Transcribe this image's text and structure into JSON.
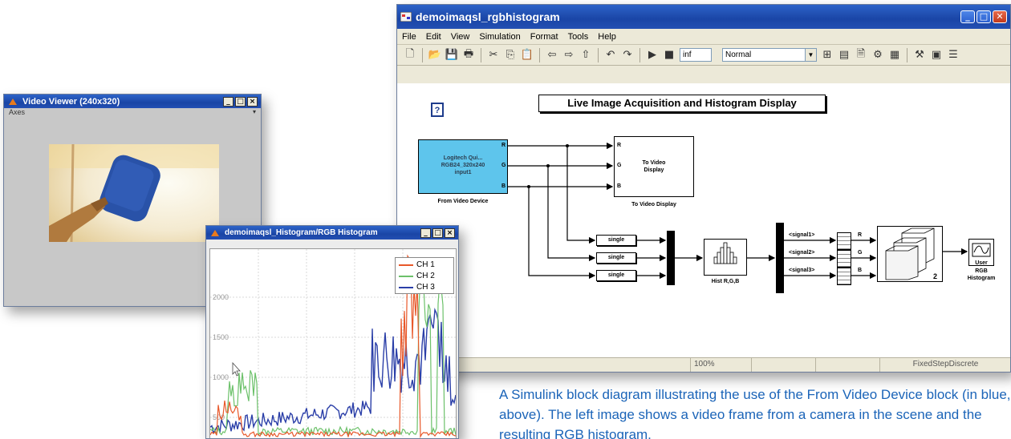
{
  "simulink": {
    "title": "demoimaqsl_rgbhistogram",
    "menu": [
      "File",
      "Edit",
      "View",
      "Simulation",
      "Format",
      "Tools",
      "Help"
    ],
    "stop_time": "inf",
    "sim_mode": "Normal",
    "diagram_title": "Live Image Acquisition and Histogram Display",
    "help_block": "?",
    "from_video": {
      "l1": "Logitech Qui...",
      "l2": "RGB24_320x240",
      "l3": "input1",
      "label": "From Video Device",
      "ports": [
        "R",
        "G",
        "B"
      ]
    },
    "to_video": {
      "l1": "To Video",
      "l2": "Display",
      "label": "To Video Display",
      "ports": [
        "R",
        "G",
        "B"
      ]
    },
    "single_blocks": [
      "single",
      "single",
      "single"
    ],
    "hist_label": "Hist R,G,B",
    "signals": [
      "<signal1>",
      "<signal2>",
      "<signal3>"
    ],
    "rgb_out": [
      "R",
      "G",
      "B"
    ],
    "matrix_num": "2",
    "scope": {
      "l1": "User",
      "l2": "RGB",
      "l3": "Histogram"
    },
    "status": [
      "100%",
      "FixedStepDiscrete"
    ]
  },
  "video_viewer": {
    "title": "Video Viewer (240x320)",
    "menu": "Axes"
  },
  "histogram": {
    "title": "demoimaqsl_Histogram/RGB Histogram",
    "legend": [
      "CH 1",
      "CH 2",
      "CH 3"
    ],
    "yticks": [
      "2000",
      "1500",
      "1000",
      "500"
    ],
    "colors": {
      "ch1": "#e8582a",
      "ch2": "#6cc16a",
      "ch3": "#2b3fa8"
    }
  },
  "caption": "A Simulink block diagram illustrating the use of the From Video Device block (in blue, above). The left image shows a video frame from a camera in the scene and the resulting RGB histogram."
}
